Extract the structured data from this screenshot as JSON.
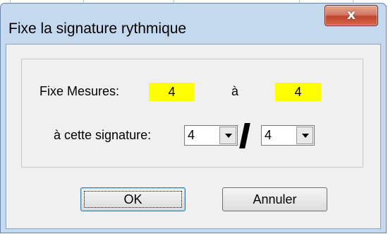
{
  "window": {
    "title": "Fixe la signature rythmique",
    "close_label": "x"
  },
  "measures": {
    "label": "Fixe Mesures:",
    "from_value": "4",
    "to_label": "à",
    "to_value": "4"
  },
  "signature": {
    "label": "à cette signature:",
    "numerator": "4",
    "separator": "/",
    "denominator": "4"
  },
  "buttons": {
    "ok_label": "OK",
    "cancel_label": "Annuler"
  },
  "colors": {
    "field_highlight": "#ffff00",
    "window_frame": "#c5d9ee",
    "close_button": "#c2452c"
  },
  "icons": {
    "close": "close-icon",
    "dropdown": "chevron-down-icon"
  }
}
